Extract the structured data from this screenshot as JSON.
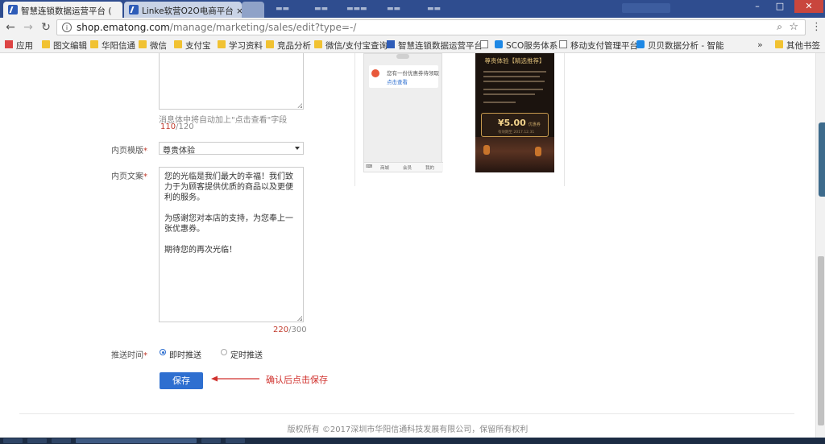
{
  "browser": {
    "tabs": [
      {
        "title": "智慧连锁数据运营平台 (",
        "active": true
      },
      {
        "title": "Linke软营O2O电商平台 ×",
        "active": false
      }
    ],
    "url_host": "shop.ematong.com",
    "url_path": "/manage/marketing/sales/edit?type=-/",
    "bookmarks": [
      {
        "label": "应用",
        "icon": "apps-icon"
      },
      {
        "label": "图文编辑",
        "icon": "folder-icon"
      },
      {
        "label": "华阳信通",
        "icon": "folder-icon"
      },
      {
        "label": "微信",
        "icon": "folder-icon"
      },
      {
        "label": "支付宝",
        "icon": "folder-icon"
      },
      {
        "label": "学习资料",
        "icon": "folder-icon"
      },
      {
        "label": "竞品分析",
        "icon": "folder-icon"
      },
      {
        "label": "微信/支付宝查询",
        "icon": "folder-icon"
      },
      {
        "label": "智慧连锁数据运营平台",
        "icon": "app-icon"
      },
      {
        "label": "",
        "icon": "page-icon"
      },
      {
        "label": "SCO服务体系",
        "icon": "bei-icon"
      },
      {
        "label": "移动支付管理平台",
        "icon": "page-icon"
      },
      {
        "label": "贝贝数据分析 - 智能",
        "icon": "bei-icon"
      }
    ],
    "more_label": "»",
    "other_bookmarks": "其他书签"
  },
  "form": {
    "top_textarea_hint": "消息体中将自动加上\"点击查看\"字段",
    "top_counter_current": "110",
    "top_counter_max": "/120",
    "inner_template_label": "内页模版",
    "inner_template_value": "尊贵体验",
    "inner_copy_label": "内页文案",
    "inner_copy_paragraphs": [
      "您的光临是我们最大的幸福！我们致力于为顾客提供优质的商品以及更便利的服务。",
      "为感谢您对本店的支持，为您奉上一张优惠券。",
      "期待您的再次光临！"
    ],
    "inner_counter_current": "220",
    "inner_counter_max": "/300",
    "push_time_label": "推送时间",
    "push_now": "即时推送",
    "push_scheduled": "定时推送",
    "save_label": "保存",
    "annotation": "确认后点击保存"
  },
  "preview": {
    "phone_msg_line1": "您有一份优惠券待领取",
    "phone_msg_line2": "点击查看",
    "phone_footer": [
      "商城",
      "会员",
      "我的"
    ],
    "poster_header": "尊贵体验【精选推荐】",
    "coupon_amount": "¥5.00",
    "coupon_unit": "优惠券",
    "coupon_sub": "有效期至 2017.12.31"
  },
  "footer": {
    "copyright": "版权所有 ©2017深圳市华阳信通科技发展有限公司，保留所有权利"
  }
}
